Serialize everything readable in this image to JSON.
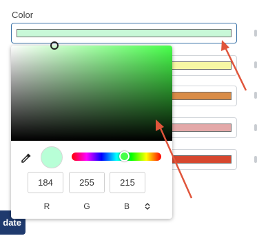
{
  "labels": {
    "color": "Color",
    "update": "date"
  },
  "swatches": [
    {
      "color": "#c8f8d8"
    },
    {
      "color": "#f7f7a4"
    },
    {
      "color": "#d98c47"
    },
    {
      "color": "#e3a8a8"
    },
    {
      "color": "#d6472f"
    }
  ],
  "picker": {
    "hue_color": "#47ff4a",
    "preview_color": "#b8ffd7",
    "rgb": {
      "r": "184",
      "g": "255",
      "b": "215"
    },
    "channel_labels": {
      "r": "R",
      "g": "G",
      "b": "B"
    },
    "mode_toggle_icon": "chevron-updown-icon",
    "eyedropper_icon": "eyedropper-icon"
  },
  "colors": {
    "accent": "#3b73a8",
    "button": "#1f3a6e",
    "annotation_arrow": "#e0553b"
  }
}
